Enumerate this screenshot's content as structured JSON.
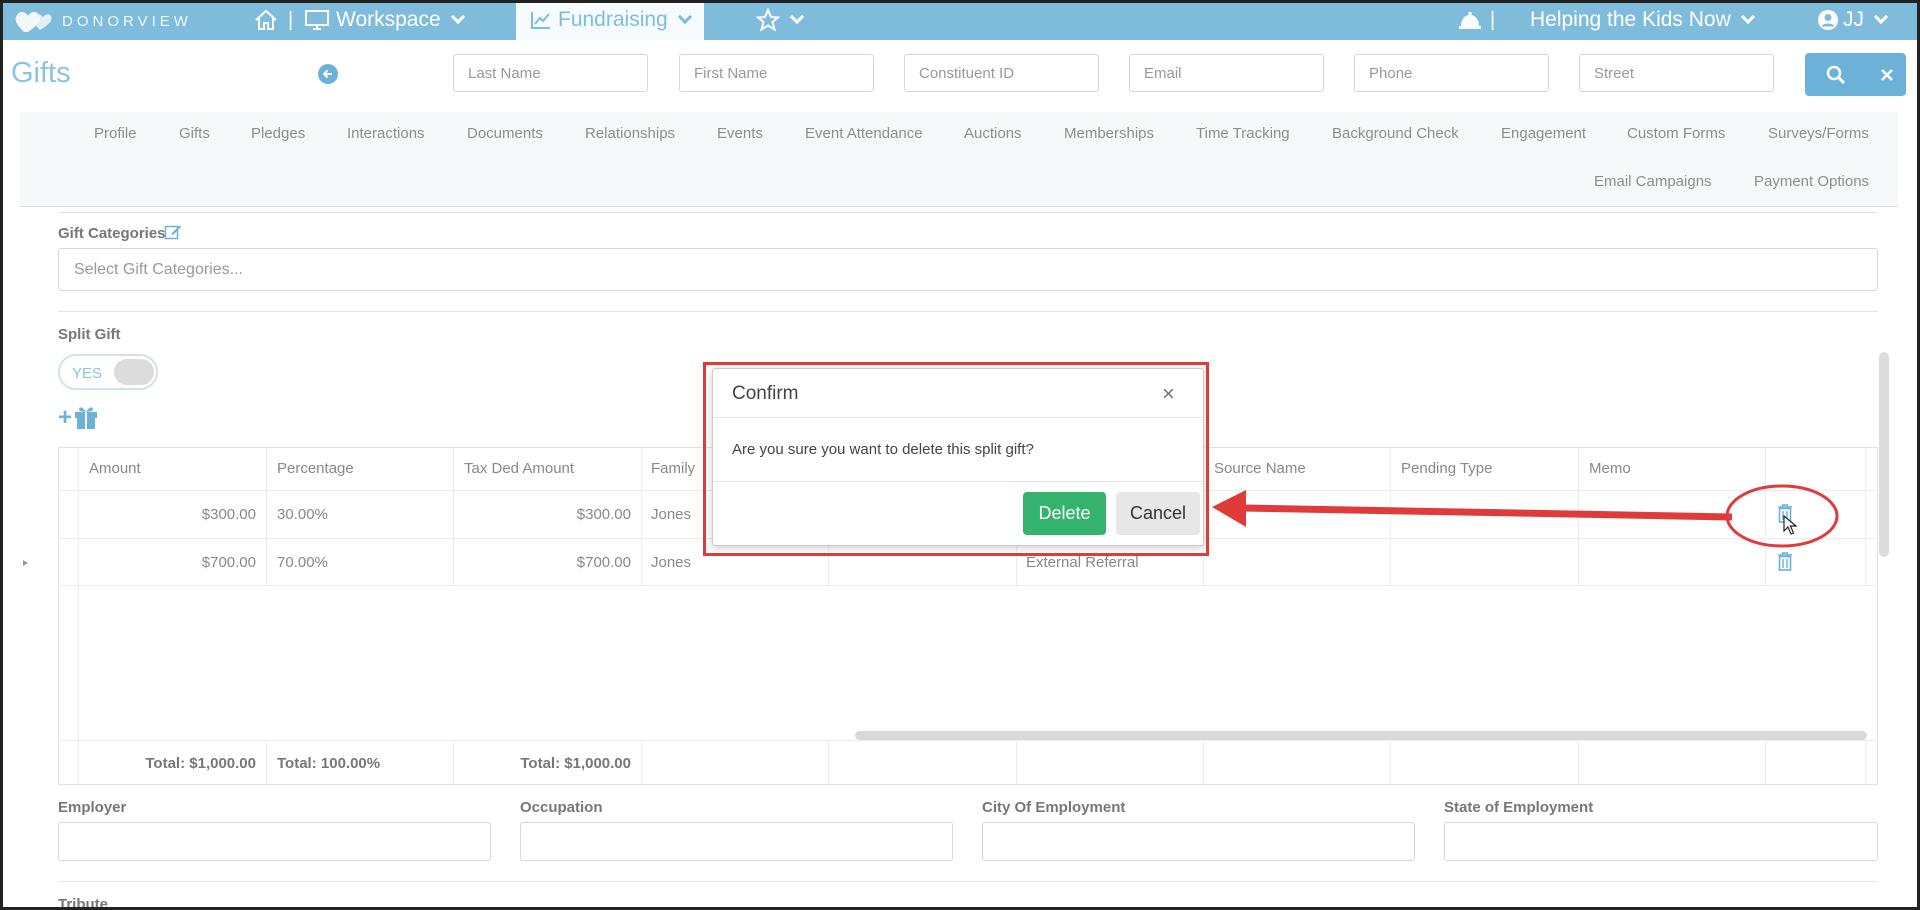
{
  "topbar": {
    "logo": "DONORVIEW",
    "workspace": "Workspace",
    "fundraising": "Fundraising",
    "sep": "|",
    "organization": "Helping the Kids Now",
    "user": "JJ"
  },
  "header": {
    "title": "Gifts",
    "search": {
      "last_name": "Last Name",
      "first_name": "First Name",
      "constituent_id": "Constituent ID",
      "email": "Email",
      "phone": "Phone",
      "street": "Street"
    }
  },
  "tabs": [
    "Profile",
    "Gifts",
    "Pledges",
    "Interactions",
    "Documents",
    "Relationships",
    "Events",
    "Event Attendance",
    "Auctions",
    "Memberships",
    "Time Tracking",
    "Background Check",
    "Engagement",
    "Custom Forms",
    "Surveys/Forms",
    "Email Campaigns",
    "Payment Options"
  ],
  "form": {
    "gift_categories_label": "Gift Categories",
    "gift_categories_placeholder": "Select Gift Categories...",
    "split_gift_label": "Split Gift",
    "split_toggle": "YES",
    "add_plus": "+",
    "employer_label": "Employer",
    "occupation_label": "Occupation",
    "city_label": "City Of Employment",
    "state_label": "State of Employment",
    "tribute_label": "Tribute"
  },
  "grid": {
    "headers": {
      "amount": "Amount",
      "percentage": "Percentage",
      "tax": "Tax Ded Amount",
      "family": "Family",
      "source_name": "Source Name",
      "pending_type": "Pending Type",
      "memo": "Memo"
    },
    "rows": [
      {
        "amount": "$300.00",
        "percentage": "30.00%",
        "tax": "$300.00",
        "family": "Jones",
        "source": ""
      },
      {
        "amount": "$700.00",
        "percentage": "70.00%",
        "tax": "$700.00",
        "family": "Jones",
        "source": "External Referral"
      }
    ],
    "totals": {
      "amount": "Total: $1,000.00",
      "percentage": "Total: 100.00%",
      "tax": "Total: $1,000.00"
    }
  },
  "modal": {
    "title": "Confirm",
    "close": "×",
    "message": "Are you sure you want to delete this split gift?",
    "delete": "Delete",
    "cancel": "Cancel"
  },
  "colors": {
    "brand": "#7fbcdc",
    "delete_button": "#33b36b",
    "annotation": "#e03b3b"
  }
}
